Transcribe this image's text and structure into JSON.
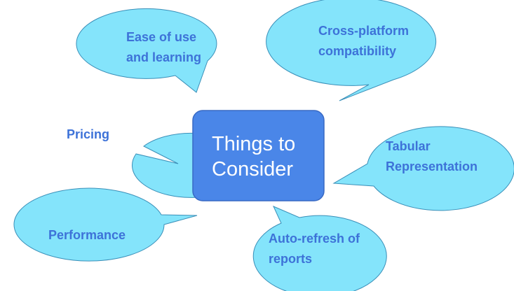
{
  "center": {
    "line1": "Things to",
    "line2": "Consider"
  },
  "bubbles": {
    "ease": {
      "line1": "Ease of use",
      "line2": "and learning"
    },
    "cross": {
      "line1": "Cross-platform",
      "line2": "compatibility"
    },
    "pricing": {
      "line1": "Pricing"
    },
    "tabular": {
      "line1": "Tabular",
      "line2": "Representation"
    },
    "performance": {
      "line1": "Performance"
    },
    "autorefresh": {
      "line1": "Auto-refresh of",
      "line2": "reports"
    }
  },
  "colors": {
    "bubble_fill": "#84e4fb",
    "bubble_stroke": "#3a8fb8",
    "bubble_text": "#3d72d8",
    "center_fill": "#4a86e8",
    "center_text": "#ffffff"
  }
}
